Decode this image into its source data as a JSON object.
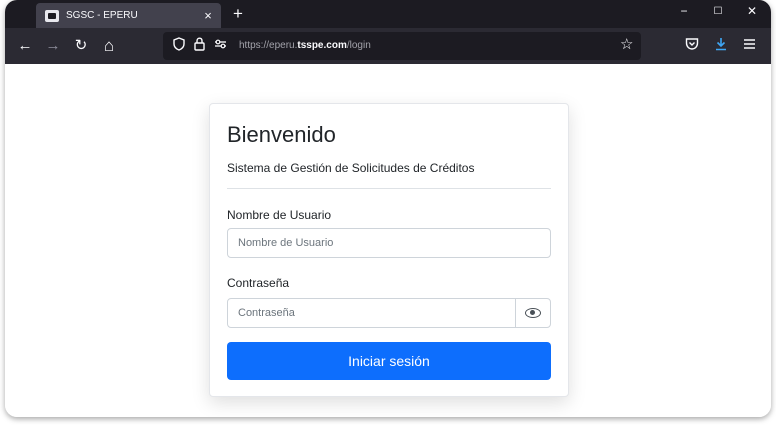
{
  "browser": {
    "tab_title": "SGSC - EPERU",
    "tab_close": "×",
    "new_tab": "+",
    "window_controls": {
      "minimize": "−",
      "maximize": "☐",
      "close": "✕"
    },
    "nav": {
      "back": "←",
      "forward": "→",
      "reload": "↻",
      "home": "⌂"
    },
    "url": {
      "prefix": "https://eperu.",
      "domain": "tsspe.com",
      "path": "/login"
    },
    "icons": [
      "shield-icon",
      "lock-icon",
      "permissions-icon",
      "bookmark-star-icon",
      "pocket-icon",
      "download-icon",
      "menu-icon"
    ],
    "accent_color": "#0d6efd"
  },
  "login": {
    "title": "Bienvenido",
    "subtitle": "Sistema de Gestión de Solicitudes de Créditos",
    "username": {
      "label": "Nombre de Usuario",
      "placeholder": "Nombre de Usuario"
    },
    "password": {
      "label": "Contraseña",
      "placeholder": "Contraseña"
    },
    "submit_label": "Iniciar sesión"
  }
}
